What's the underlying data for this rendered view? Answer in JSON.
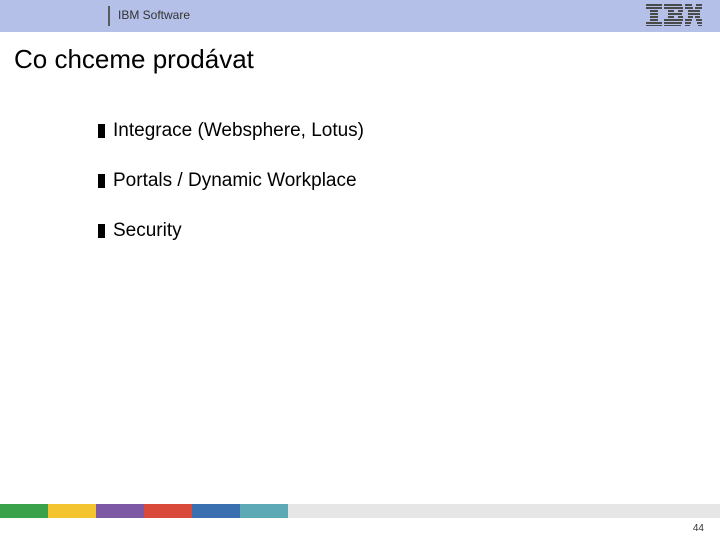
{
  "header": {
    "label": "IBM Software",
    "logo_alt": "IBM"
  },
  "title": "Co chceme prodávat",
  "bullets": [
    "Integrace (Websphere, Lotus)",
    "Portals / Dynamic Workplace",
    "Security"
  ],
  "footer": {
    "stripe_colors": [
      "#3aa24a",
      "#f4c430",
      "#7c58a5",
      "#d94a3a",
      "#3a6fb0",
      "#5da9b5",
      "#e6e6e6"
    ],
    "page_number": "44"
  }
}
